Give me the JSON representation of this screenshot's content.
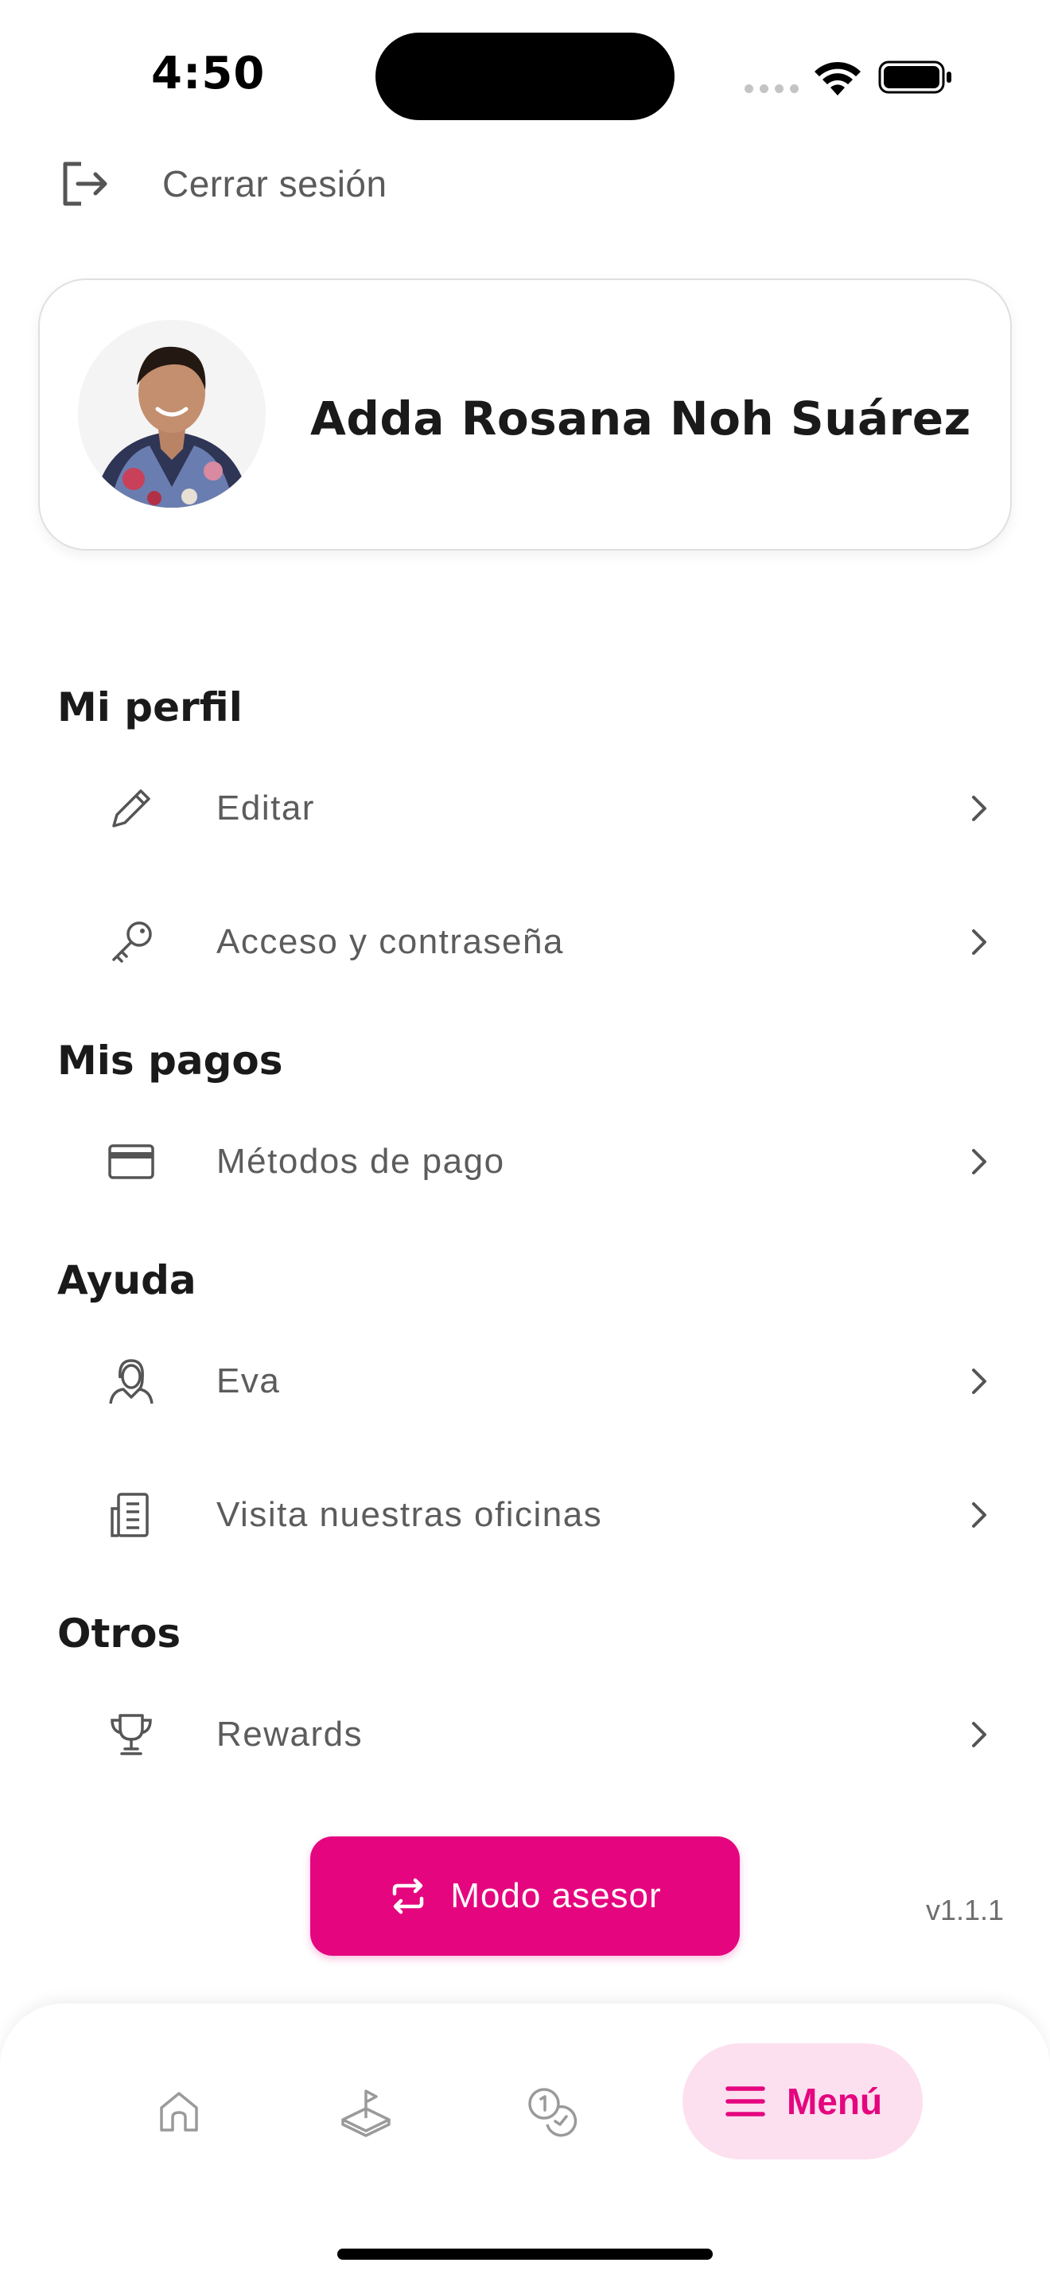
{
  "status_bar": {
    "time": "4:50"
  },
  "logout": {
    "label": "Cerrar sesión"
  },
  "profile": {
    "name": "Adda Rosana Noh Suárez"
  },
  "sections": {
    "profile": {
      "title": "Mi perfil",
      "items": [
        {
          "label": "Editar",
          "icon": "pencil-icon"
        },
        {
          "label": "Acceso y contraseña",
          "icon": "key-icon"
        }
      ]
    },
    "payments": {
      "title": "Mis pagos",
      "items": [
        {
          "label": "Métodos de pago",
          "icon": "credit-card-icon"
        }
      ]
    },
    "help": {
      "title": "Ayuda",
      "items": [
        {
          "label": "Eva",
          "icon": "assistant-icon"
        },
        {
          "label": "Visita nuestras oficinas",
          "icon": "building-icon"
        }
      ]
    },
    "others": {
      "title": "Otros",
      "items": [
        {
          "label": "Rewards",
          "icon": "trophy-icon"
        }
      ]
    }
  },
  "asesor_button": {
    "label": "Modo asesor",
    "icon": "swap-icon"
  },
  "version": "v1.1.1",
  "bottom_nav": {
    "items": [
      {
        "icon": "home-icon"
      },
      {
        "icon": "land-plot-icon"
      },
      {
        "icon": "coins-icon"
      },
      {
        "icon": "menu-icon",
        "label": "Menú",
        "active": true
      }
    ]
  },
  "colors": {
    "accent": "#e5067f",
    "accent_soft": "#fde0ef",
    "text_muted": "#5c5c5c"
  }
}
